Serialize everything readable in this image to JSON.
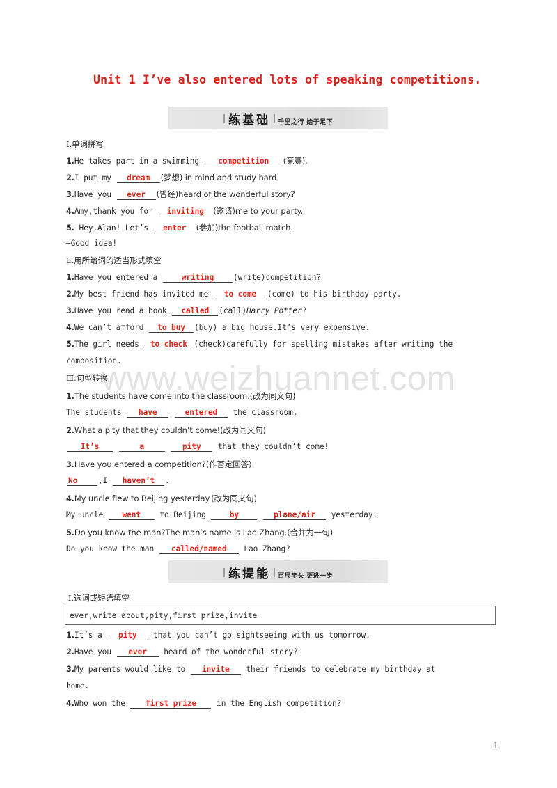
{
  "document": {
    "unit_title": "Unit 1  I’ve also entered lots of speaking competitions.",
    "page_number": "1",
    "watermark": "www.weizhuannet.com",
    "title_color": "#d9251d",
    "answer_color": "#e3241b"
  },
  "banners": [
    {
      "main": "练基础",
      "sub": "千里之行  始于足下"
    },
    {
      "main": "练提能",
      "sub": "百尺竿头  更进一步"
    }
  ],
  "section1": {
    "heading": "Ⅰ.单词拼写",
    "items": [
      {
        "num": "1.",
        "pre": "He takes part in a swimming ",
        "blank": "competition",
        "post": "(竞赛)."
      },
      {
        "num": "2.",
        "pre": "I put my ",
        "blank": "dream",
        "post": "(梦想) in mind and study hard."
      },
      {
        "num": "3.",
        "pre": "Have you ",
        "blank": "ever",
        "post": "(曾经)heard of the wonderful story?"
      },
      {
        "num": "4.",
        "pre": "Amy,thank you for ",
        "blank": "inviting",
        "post": "(邀请)me to your party."
      },
      {
        "num": "5.",
        "pre": "—Hey,Alan! Let’s ",
        "blank": "enter",
        "post": "(参加)the football match."
      }
    ],
    "reply": "—Good idea!"
  },
  "section2": {
    "heading": "Ⅱ.用所给词的适当形式填空",
    "items": [
      {
        "num": "1.",
        "pre": "Have you entered a ",
        "blank": "writing",
        "post": "(write)competition?"
      },
      {
        "num": "2.",
        "pre": "My best friend has invited me ",
        "blank": "to come",
        "post": "(come) to his birthday party."
      },
      {
        "num": "3.",
        "pre": "Have you read a book ",
        "blank": "called",
        "post": "(call)",
        "italic": "Harry Potter",
        "post2": "?"
      },
      {
        "num": "4.",
        "pre": "We can’t afford ",
        "blank": "to buy",
        "post": "(buy) a big house.It’s very expensive."
      },
      {
        "num": "5.",
        "pre": "The girl needs ",
        "blank": "to check",
        "post": "(check)carefully for spelling mistakes after writing the"
      }
    ],
    "wrap_line": "composition."
  },
  "section3": {
    "heading": "Ⅲ.句型转换",
    "items": [
      {
        "num": "1.",
        "question": "The students have come into the classroom.(改为同义句)",
        "answer_pre": "The students ",
        "blanks": [
          "have",
          "entered"
        ],
        "answer_post": " the classroom."
      },
      {
        "num": "2.",
        "question": "What a pity that they couldn’t come!(改为同义句)",
        "answer_pre": "",
        "blanks": [
          "It’s",
          "a",
          "pity"
        ],
        "answer_post": " that they couldn’t come!"
      },
      {
        "num": "3.",
        "question": "Have you entered a competition?(作否定回答)",
        "answer_pre": "",
        "blanks": [
          "No",
          "haven’t"
        ],
        "mid": ",I ",
        "answer_post": "."
      },
      {
        "num": "4.",
        "question": "My uncle flew to Beijing yesterday.(改为同义句)",
        "answer_pre": "My uncle ",
        "blanks": [
          "went",
          "by",
          "plane/air"
        ],
        "mid": " to Beijing ",
        "answer_post": " yesterday."
      },
      {
        "num": "5.",
        "question": "Do you know the man?The man’s name is Lao Zhang.(合并为一句)",
        "answer_pre": "Do you know the man ",
        "blanks": [
          "called/named"
        ],
        "answer_post": " Lao Zhang?"
      }
    ]
  },
  "section4": {
    "heading": "Ⅰ.选词或短语填空",
    "wordbank": "ever,write about,pity,first prize,invite",
    "items": [
      {
        "num": "1.",
        "pre": "It’s a ",
        "blank": "pity",
        "post": " that you can’t go sightseeing with us tomorrow."
      },
      {
        "num": "2.",
        "pre": "Have you ",
        "blank": "ever",
        "post": " heard of the wonderful story?"
      },
      {
        "num": "3.",
        "pre": "My parents would like to ",
        "blank": "invite",
        "post": " their friends to celebrate my birthday at"
      },
      {
        "num": "4.",
        "pre": "Who won the ",
        "blank": "first prize",
        "post": " in the English competition?"
      }
    ],
    "wrap_line": "home."
  }
}
